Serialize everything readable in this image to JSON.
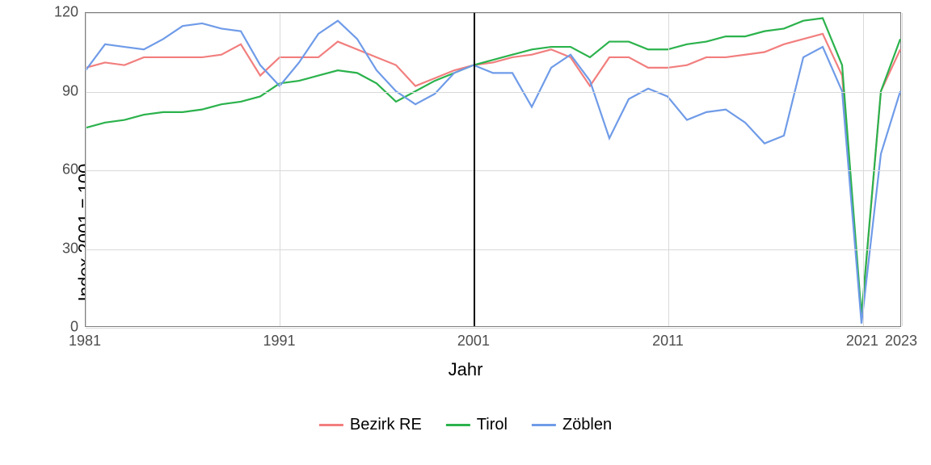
{
  "chart_data": {
    "type": "line",
    "title": "",
    "xlabel": "Jahr",
    "ylabel": "Index 2001 = 100",
    "xlim": [
      1981,
      2023
    ],
    "ylim": [
      0,
      120
    ],
    "x_ticks": [
      1981,
      1991,
      2001,
      2011,
      2021,
      2023
    ],
    "y_ticks": [
      0,
      30,
      60,
      90,
      120
    ],
    "reference_x": 2001,
    "x": [
      1981,
      1982,
      1983,
      1984,
      1985,
      1986,
      1987,
      1988,
      1989,
      1990,
      1991,
      1992,
      1993,
      1994,
      1995,
      1996,
      1997,
      1998,
      1999,
      2000,
      2001,
      2002,
      2003,
      2004,
      2005,
      2006,
      2007,
      2008,
      2009,
      2010,
      2011,
      2012,
      2013,
      2014,
      2015,
      2016,
      2017,
      2018,
      2019,
      2020,
      2021,
      2022,
      2023
    ],
    "series": [
      {
        "name": "Bezirk RE",
        "color": "#f27e7e",
        "values": [
          99,
          101,
          100,
          103,
          103,
          103,
          103,
          104,
          108,
          96,
          103,
          103,
          103,
          109,
          106,
          103,
          100,
          92,
          95,
          98,
          100,
          101,
          103,
          104,
          106,
          103,
          92,
          103,
          103,
          99,
          99,
          100,
          103,
          103,
          104,
          105,
          108,
          110,
          112,
          96,
          3,
          90,
          106
        ]
      },
      {
        "name": "Tirol",
        "color": "#2bb24c",
        "values": [
          76,
          78,
          79,
          81,
          82,
          82,
          83,
          85,
          86,
          88,
          93,
          94,
          96,
          98,
          97,
          93,
          86,
          90,
          94,
          97,
          100,
          102,
          104,
          106,
          107,
          107,
          103,
          109,
          109,
          106,
          106,
          108,
          109,
          111,
          111,
          113,
          114,
          117,
          118,
          100,
          4,
          90,
          110
        ]
      },
      {
        "name": "Zöblen",
        "color": "#6f9be8",
        "values": [
          98,
          108,
          107,
          106,
          110,
          115,
          116,
          114,
          113,
          100,
          92,
          101,
          112,
          117,
          110,
          98,
          90,
          85,
          89,
          97,
          100,
          97,
          97,
          84,
          99,
          104,
          94,
          72,
          87,
          91,
          88,
          79,
          82,
          83,
          78,
          70,
          73,
          103,
          107,
          90,
          1,
          66,
          90
        ]
      }
    ],
    "legend": [
      "Bezirk RE",
      "Tirol",
      "Zöblen"
    ]
  }
}
